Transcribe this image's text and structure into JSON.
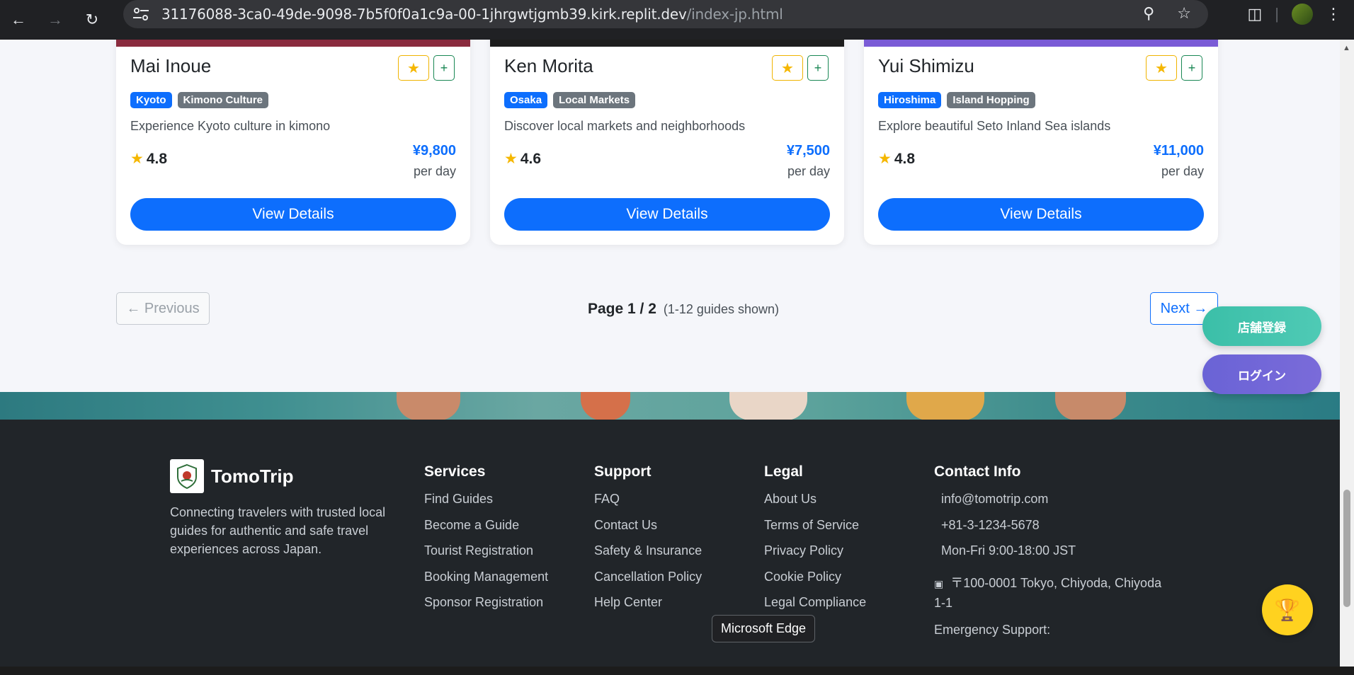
{
  "browser": {
    "url_host": "31176088-3ca0-49de-9098-7b5f0f0a1c9a-00-1jhrgwtjgmb39.kirk.replit.dev",
    "url_path": "/index-jp.html"
  },
  "cards": [
    {
      "name": "Mai Inoue",
      "location": "Kyoto",
      "category": "Kimono Culture",
      "description": "Experience Kyoto culture in kimono",
      "rating": "4.8",
      "price": "¥9,800",
      "per": "per day",
      "button": "View Details",
      "image_color": "#8a2b3e"
    },
    {
      "name": "Ken Morita",
      "location": "Osaka",
      "category": "Local Markets",
      "description": "Discover local markets and neighborhoods",
      "rating": "4.6",
      "price": "¥7,500",
      "per": "per day",
      "button": "View Details",
      "image_color": "#1d1d1d"
    },
    {
      "name": "Yui Shimizu",
      "location": "Hiroshima",
      "category": "Island Hopping",
      "description": "Explore beautiful Seto Inland Sea islands",
      "rating": "4.8",
      "price": "¥11,000",
      "per": "per day",
      "button": "View Details",
      "image_color": "#7a5bd6"
    }
  ],
  "pagination": {
    "prev": "← Previous",
    "page_label": "Page 1 / 2",
    "count": "(1-12 guides shown)",
    "next": "Next →"
  },
  "floating": {
    "store_register": "店舗登録",
    "login": "ログイン"
  },
  "footer": {
    "brand": "TomoTrip",
    "description": "Connecting travelers with trusted local guides for authentic and safe travel experiences across Japan.",
    "services": {
      "title": "Services",
      "items": [
        "Find Guides",
        "Become a Guide",
        "Tourist Registration",
        "Booking Management",
        "Sponsor Registration"
      ]
    },
    "support": {
      "title": "Support",
      "items": [
        "FAQ",
        "Contact Us",
        "Safety & Insurance",
        "Cancellation Policy",
        "Help Center"
      ]
    },
    "legal": {
      "title": "Legal",
      "items": [
        "About Us",
        "Terms of Service",
        "Privacy Policy",
        "Cookie Policy",
        "Legal Compliance"
      ]
    },
    "contact": {
      "title": "Contact Info",
      "email": "info@tomotrip.com",
      "phone": "+81-3-1234-5678",
      "hours": "Mon-Fri 9:00-18:00 JST",
      "address": "〒100-0001 Tokyo, Chiyoda, Chiyoda 1-1",
      "emergency": "Emergency Support:"
    }
  },
  "tooltip": "Microsoft Edge",
  "colors": {
    "primary": "#0d6efd",
    "footer_bg": "#212529",
    "teal": "#3bbfa8",
    "purple": "#6a63d6",
    "trophy": "#ffd21f"
  }
}
